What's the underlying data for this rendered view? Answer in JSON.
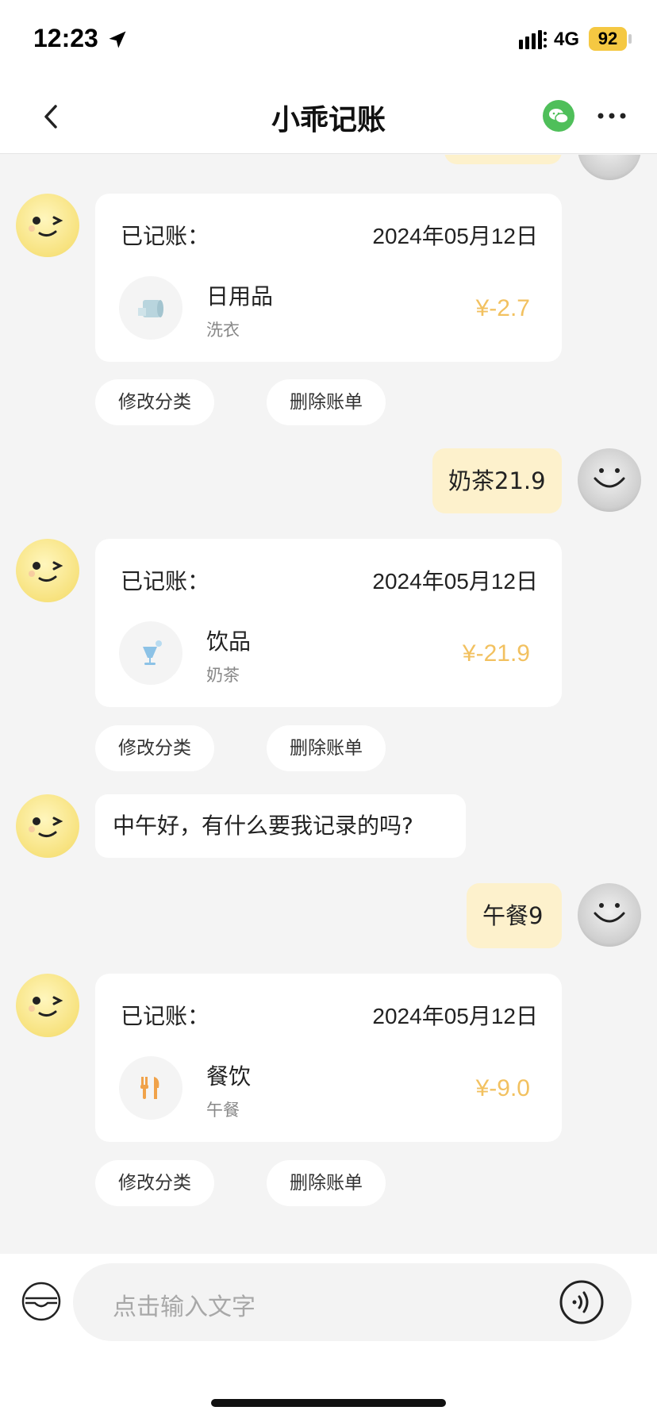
{
  "status_bar": {
    "time": "12:23",
    "network": "4G",
    "battery": "92"
  },
  "nav": {
    "title": "小乖记账"
  },
  "messages": {
    "card1": {
      "label": "已记账：",
      "date": "2024年05月12日",
      "category": "日用品",
      "note": "洗衣",
      "amount": "¥-2.7"
    },
    "card1_actions": {
      "edit": "修改分类",
      "delete": "删除账单"
    },
    "user1": "奶茶21.9",
    "card2": {
      "label": "已记账：",
      "date": "2024年05月12日",
      "category": "饮品",
      "note": "奶茶",
      "amount": "¥-21.9"
    },
    "card2_actions": {
      "edit": "修改分类",
      "delete": "删除账单"
    },
    "bot_greeting": "中午好，有什么要我记录的吗?",
    "user2": "午餐9",
    "card3": {
      "label": "已记账：",
      "date": "2024年05月12日",
      "category": "餐饮",
      "note": "午餐",
      "amount": "¥-9.0"
    },
    "card3_actions": {
      "edit": "修改分类",
      "delete": "删除账单"
    }
  },
  "input": {
    "placeholder": "点击输入文字"
  },
  "colors": {
    "amount": "#f2c160",
    "user_bubble": "#fdf1cc",
    "wechat": "#4fbf5a",
    "background": "#f4f4f4"
  }
}
